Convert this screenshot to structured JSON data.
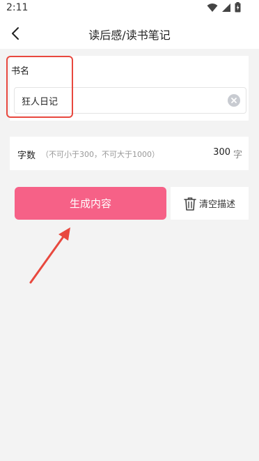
{
  "status": {
    "time": "2:11",
    "icons": [
      "wifi-icon",
      "signal-icon",
      "battery-icon"
    ]
  },
  "nav": {
    "title": "读后感/读书笔记",
    "back_icon": "chevron-left-icon"
  },
  "book": {
    "label": "书名",
    "value": "狂人日记",
    "placeholder": "",
    "clear_icon": "clear-circle-icon"
  },
  "word_count": {
    "label": "字数",
    "hint": "（不可小于300，不可大于1000）",
    "value": "300",
    "unit": "字"
  },
  "actions": {
    "generate_label": "生成内容",
    "clear_label": "清空描述",
    "clear_icon": "trash-icon"
  },
  "colors": {
    "primary": "#f66187",
    "annotation": "#e8483e",
    "background": "#f3f3f3"
  }
}
